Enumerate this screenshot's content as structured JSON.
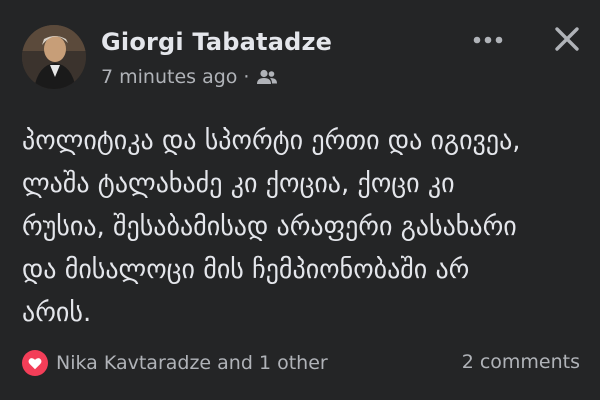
{
  "post": {
    "author": "Giorgi Tabatadze",
    "timestamp": "7 minutes ago",
    "separator": "·",
    "audience_icon": "friends-icon",
    "text_lines": [
      "პოლიტიკა და სპორტი ერთი და იგივეა,",
      "ლაშა ტალახაძე კი ქოცია, ქოცი კი",
      "რუსია, შესაბამისად არაფერი გასახარი",
      "და მისალოცი მის ჩემპიონობაში არ",
      "არის."
    ],
    "reactions": {
      "icon": "love-heart-icon",
      "summary": "Nika Kavtaradze and 1 other"
    },
    "comments_label": "2 comments"
  },
  "colors": {
    "background": "#242526",
    "primary_text": "#e4e6eb",
    "secondary_text": "#b0b3b8",
    "love_reaction": "#f33e58"
  },
  "icons": {
    "more": "more-options-icon",
    "close": "close-icon"
  }
}
